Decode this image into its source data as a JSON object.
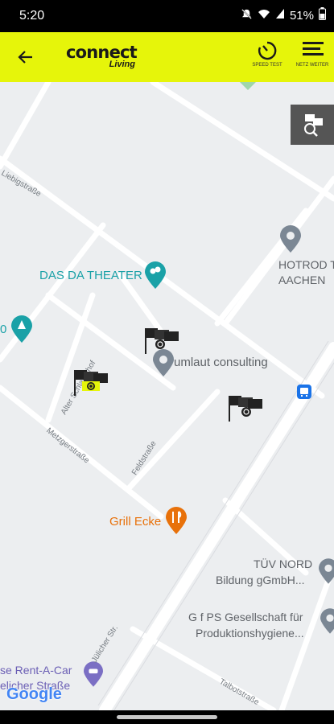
{
  "status_bar": {
    "time": "5:20",
    "battery": "51%"
  },
  "app_bar": {
    "logo_main": "connect",
    "logo_sub": "Living",
    "speed_test_label": "SPEED TEST",
    "netz_weiter_label": "NETZ WEITER"
  },
  "map": {
    "pois": {
      "theater": "DAS DA THEATER",
      "hotrod_line1": "HOTROD T",
      "hotrod_line2": "AACHEN",
      "umlaut": "umlaut consulting",
      "grill": "Grill Ecke",
      "tuv_line1": "TÜV NORD",
      "tuv_line2": "Bildung gGmbH...",
      "gfps_line1": "G f PS Gesellschaft für",
      "gfps_line2": "Produktionshygiene...",
      "rent_line1": "se Rent-A-Car",
      "rent_line2": "elicher Straße",
      "partial_left": "0"
    },
    "streets": {
      "liebig": "Liebigstraße",
      "alter": "Alter Schlachthof",
      "metzger": "Metzgerstraße",
      "feld": "Feldstraße",
      "juelicher": "Jülicher Str.",
      "talbot": "Talbotstraße"
    },
    "attribution": "Google"
  },
  "colors": {
    "accent": "#e6f50a",
    "map_bg": "#eceef0",
    "road": "#ffffff",
    "poi_teal": "#1aa1a7",
    "poi_orange": "#e8710a",
    "pin_grey": "#7b8794"
  }
}
